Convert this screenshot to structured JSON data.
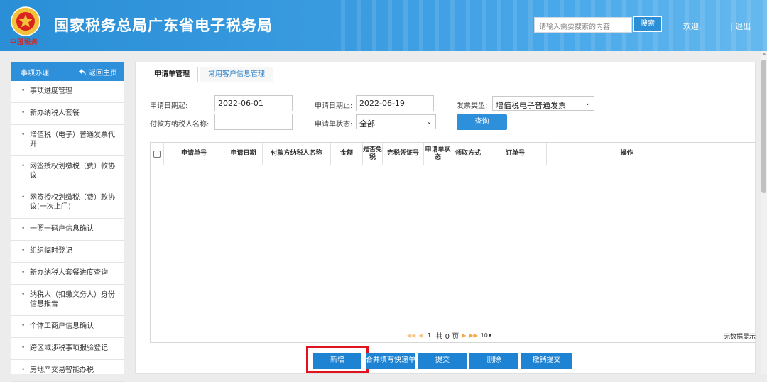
{
  "header": {
    "site_title": "国家税务总局广东省电子税务局",
    "emblem_caption": "中国税务",
    "search_placeholder": "请输入需要搜索的内容",
    "search_button": "搜索",
    "welcome": "欢迎,",
    "logout": "| 退出"
  },
  "sidebar": {
    "title": "事项办理",
    "home_link": "返回主页",
    "items": [
      "事项进度管理",
      "新办纳税人套餐",
      "增值税（电子）普通发票代开",
      "网签授权划缴税（费）款协议",
      "网签授权划缴税（费）款协议(一次上门)",
      "一照一码户信息确认",
      "组织临时登记",
      "新办纳税人套餐进度查询",
      "纳税人（扣缴义务人）身份信息报告",
      "个体工商户信息确认",
      "跨区域涉税事项报验登记",
      "房地产交易智能办税"
    ]
  },
  "tabs": [
    "申请单管理",
    "常用客户信息管理"
  ],
  "form": {
    "start_date_label": "申请日期起:",
    "start_date": "2022-06-01",
    "end_date_label": "申请日期止:",
    "end_date": "2022-06-19",
    "invoice_type_label": "发票类型:",
    "invoice_type": "增值税电子普通发票",
    "payer_name_label": "付款方纳税人名称:",
    "payer_name": "",
    "status_label": "申请单状态:",
    "status": "全部",
    "query_button": "查询"
  },
  "table": {
    "columns": [
      "申请单号",
      "申请日期",
      "付款方纳税人名称",
      "金额",
      "是否免税",
      "完税凭证号",
      "申请单状态",
      "领取方式",
      "订单号",
      "操作"
    ],
    "rows": [],
    "pager": {
      "page": "1",
      "total_text": "共 0 页",
      "page_size": "10",
      "empty_text": "无数据显示"
    }
  },
  "actions": {
    "add": "新增",
    "merge_express": "合并填写快递单",
    "submit": "提交",
    "delete": "删除",
    "revoke": "撤销提交"
  },
  "colors": {
    "header_blue": "#2a8fd6",
    "button_blue": "#1f83d4",
    "highlight_red": "#e0141e"
  }
}
